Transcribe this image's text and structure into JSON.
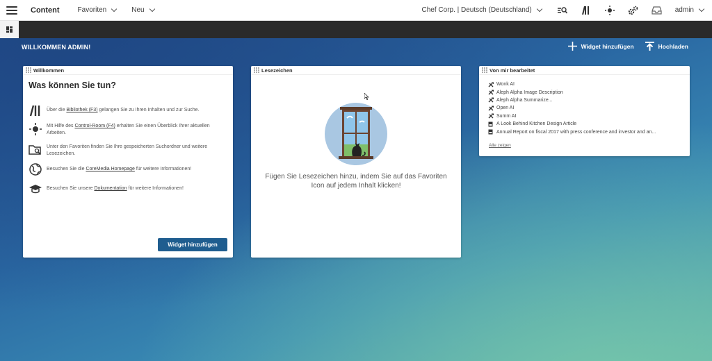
{
  "topbar": {
    "app_title": "Content",
    "menus": [
      {
        "label": "Favoriten"
      },
      {
        "label": "Neu"
      }
    ],
    "site_selector": "Chef Corp. | Deutsch (Deutschland)",
    "user": "admin",
    "icons": [
      "search-plus-icon",
      "library-icon",
      "control-room-icon",
      "settings-gears-icon",
      "inbox-icon"
    ]
  },
  "dashboard": {
    "welcome": "WILLKOMMEN ADMIN!",
    "actions": {
      "add_widget": "Widget hinzufügen",
      "upload": "Hochladen"
    }
  },
  "widget_welcome": {
    "header": "Willkommen",
    "title": "Was können Sie tun?",
    "hints": [
      {
        "pre": "Über die ",
        "link": "Bibliothek (F3)",
        "post": " gelangen Sie zu Ihren Inhalten und zur Suche.",
        "icon": "library-icon"
      },
      {
        "pre": "Mit Hilfe des ",
        "link": "Control-Room (F4)",
        "post": " erhalten Sie einen Überblick Ihrer aktuellen Arbeiten.",
        "icon": "control-room-icon"
      },
      {
        "pre": "Unter den Favoriten finden Sie Ihre gespeicherten Suchordner und weitere Lesezeichen.",
        "link": "",
        "post": "",
        "icon": "folder-search-icon"
      },
      {
        "pre": "Besuchen Sie die ",
        "link": "CoreMedia Homepage",
        "post": " für weitere Informationen!",
        "icon": "globe-icon"
      },
      {
        "pre": "Besuchen Sie unsere ",
        "link": "Dokumentation",
        "post": " für weitere Informationen!",
        "icon": "graduation-cap-icon"
      }
    ],
    "button": "Widget hinzufügen"
  },
  "widget_bookmarks": {
    "header": "Lesezeichen",
    "empty_text_1": "Fügen Sie Lesezeichen hinzu, indem Sie auf das Favoriten",
    "empty_text_2": "Icon auf jedem Inhalt klicken!"
  },
  "widget_edited": {
    "header": "Von mir bearbeitet",
    "items": [
      {
        "label": "Wonk AI",
        "icon": "tools-icon"
      },
      {
        "label": "Aleph Alpha Image Description",
        "icon": "tools-icon"
      },
      {
        "label": "Aleph Alpha Summarize...",
        "icon": "tools-icon"
      },
      {
        "label": "Open AI",
        "icon": "tools-icon"
      },
      {
        "label": "Summ AI",
        "icon": "tools-icon"
      },
      {
        "label": "A Look Behind Kitchen Design Article",
        "icon": "document-icon"
      },
      {
        "label": "Annual Report on fiscal 2017 with press conference and investor and an...",
        "icon": "document-icon"
      }
    ],
    "show_all": "Alle zeigen"
  },
  "colors": {
    "primary_button": "#1f5d8f",
    "darkbar": "#2a2a2a"
  }
}
